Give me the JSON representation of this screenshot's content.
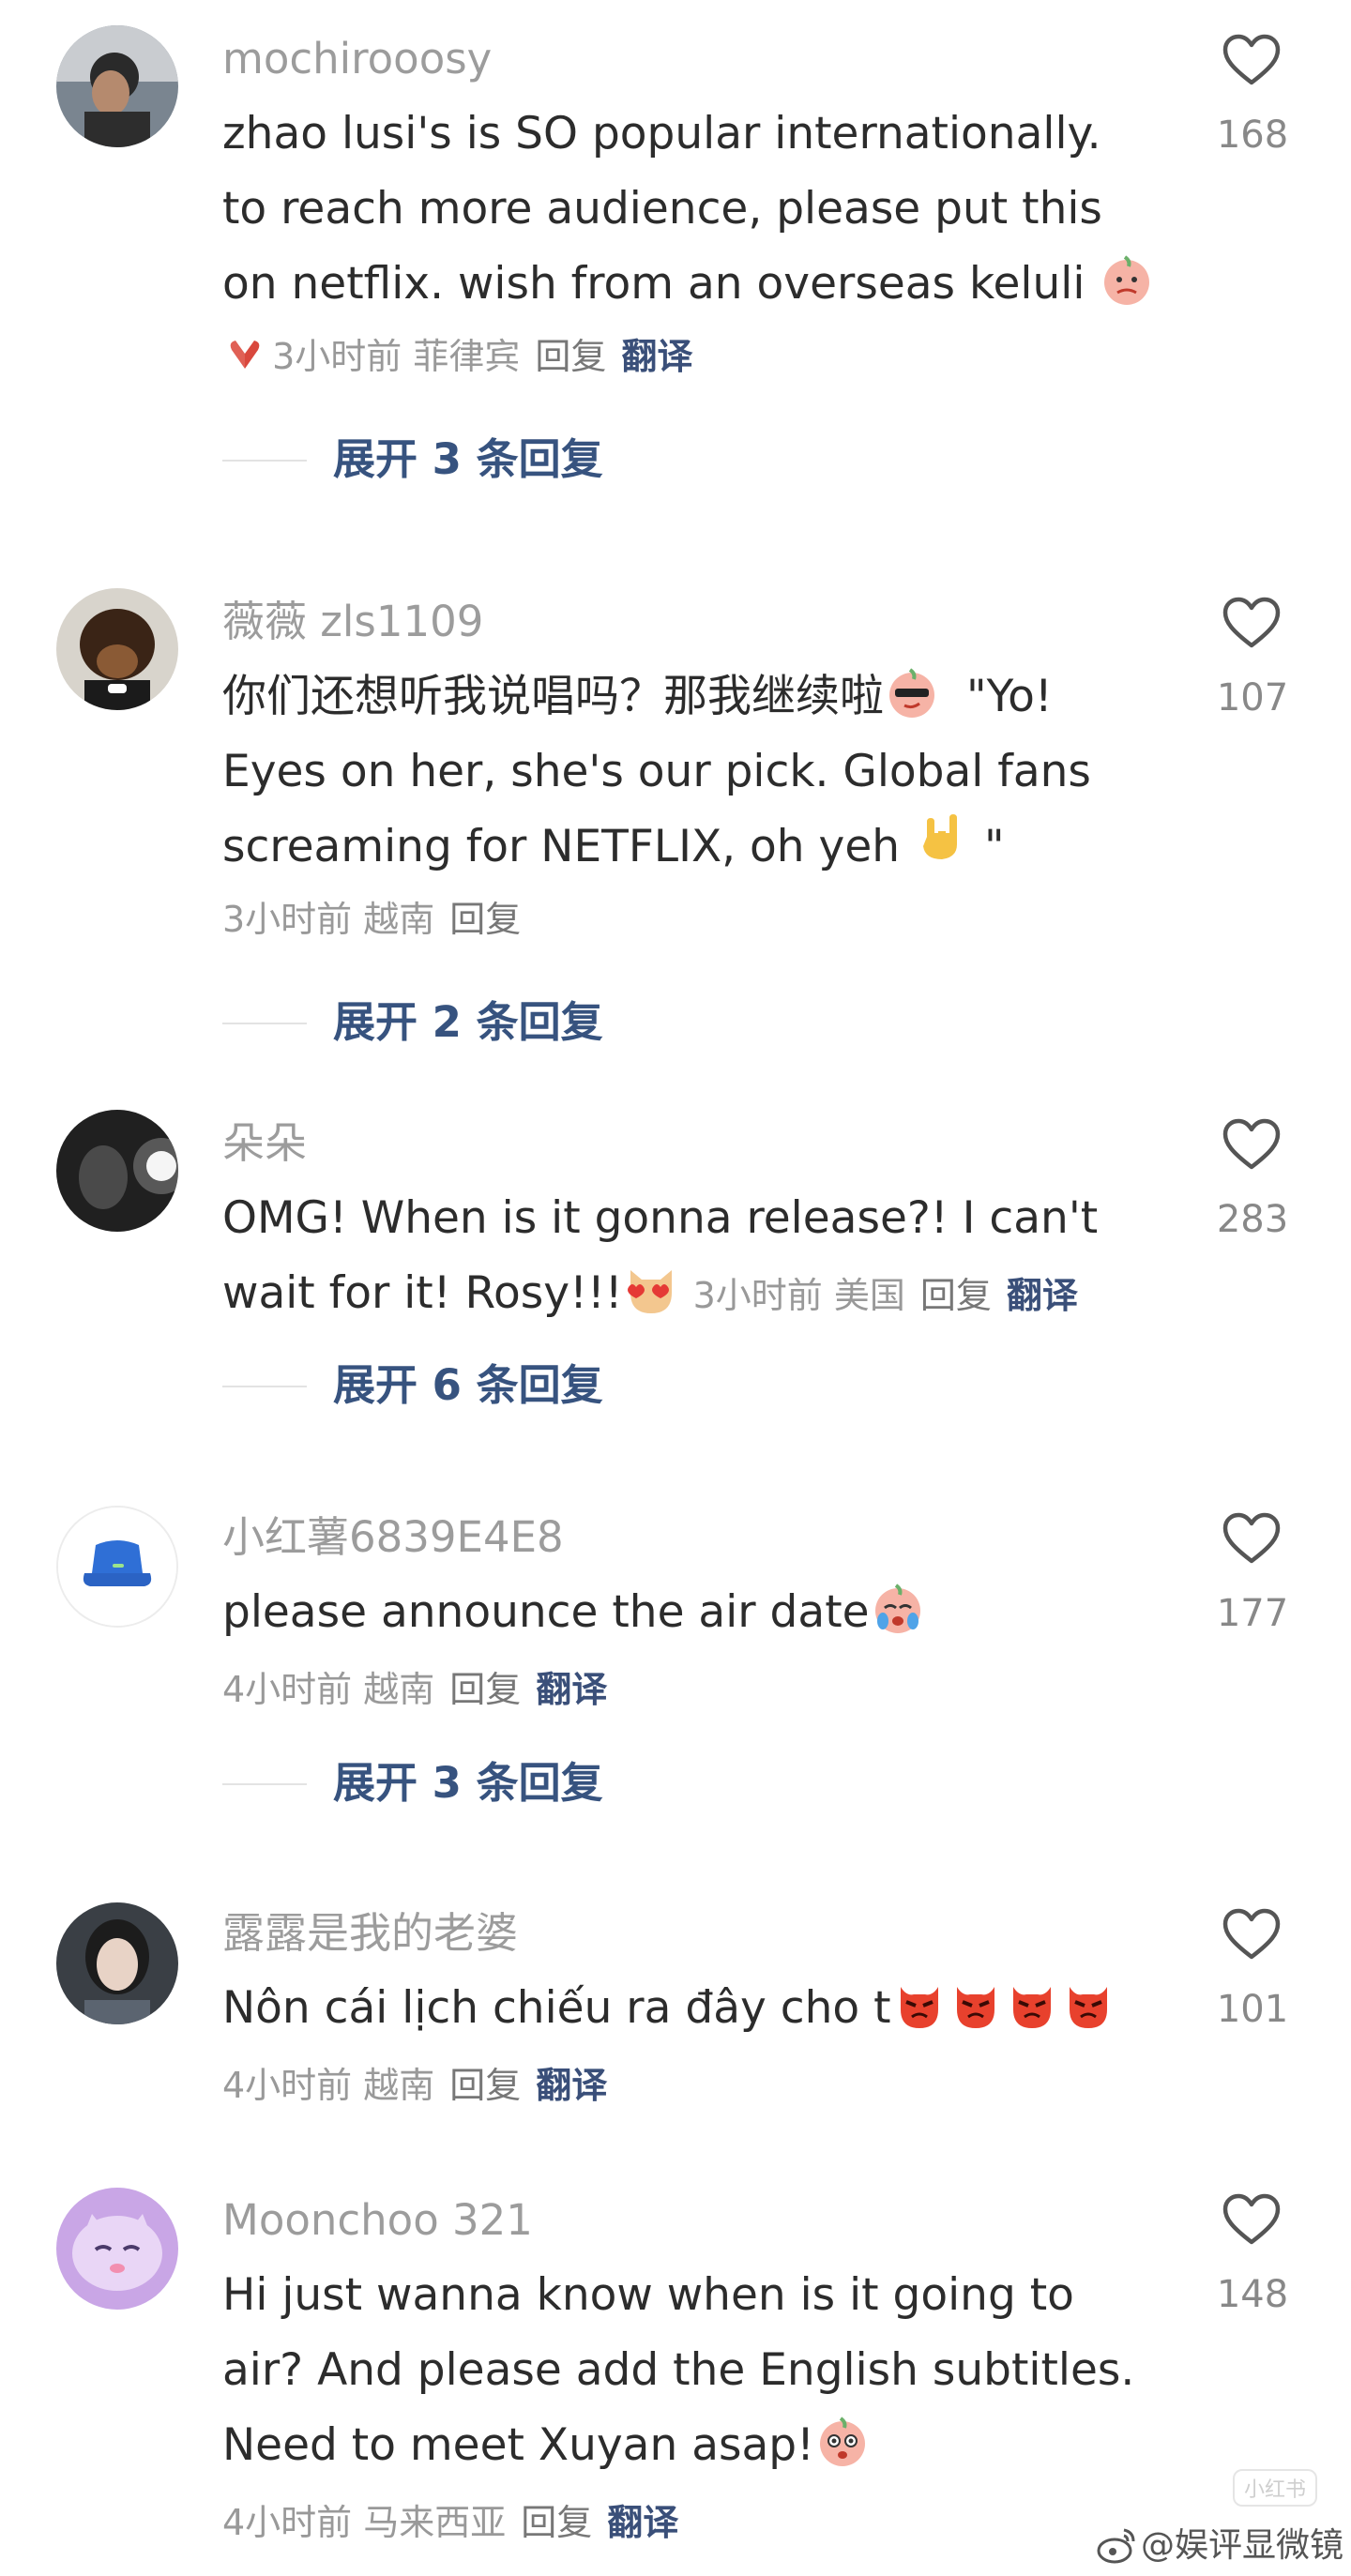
{
  "comments": [
    {
      "username": "mochirooosy",
      "lines": [
        "zhao lusi's is SO popular internationally.",
        "to reach more audience, please put this",
        "on netflix. wish from an overseas keluli"
      ],
      "meta": "3小时前 菲律宾",
      "reply": "回复",
      "translate": "翻译",
      "likes": "168",
      "expand": "展开 3 条回复"
    },
    {
      "username": "薇薇 zls1109",
      "lines": [
        "你们还想听我说唱吗？那我继续啦",
        "\"Yo!",
        "Eyes on her, she's our pick. Global fans",
        "screaming for NETFLIX, oh yeh",
        "\""
      ],
      "meta": "3小时前 越南",
      "reply": "回复",
      "likes": "107",
      "expand": "展开 2 条回复"
    },
    {
      "username": "朵朵",
      "lines": [
        "OMG! When is it gonna release?! I can't",
        "wait for it! Rosy!!!"
      ],
      "meta": "3小时前 美国",
      "reply": "回复",
      "translate": "翻译",
      "likes": "283",
      "expand": "展开 6 条回复"
    },
    {
      "username": "小红薯6839E4E8",
      "lines": [
        "please announce the air date"
      ],
      "meta": "4小时前 越南",
      "reply": "回复",
      "translate": "翻译",
      "likes": "177",
      "expand": "展开 3 条回复"
    },
    {
      "username": "露露是我的老婆",
      "lines": [
        "Nôn cái lịch chiếu ra đây cho t"
      ],
      "meta": "4小时前 越南",
      "reply": "回复",
      "translate": "翻译",
      "likes": "101"
    },
    {
      "username": "Moonchoo 321",
      "lines": [
        "Hi just wanna know when is it going to",
        "air? And please add the English subtitles.",
        "Need to meet Xuyan asap!"
      ],
      "meta": "4小时前 马来西亚",
      "reply": "回复",
      "translate": "翻译",
      "likes": "148"
    }
  ],
  "watermark": "@娱评显微镜",
  "corner_mark": "小红书",
  "icons": {
    "like": "heart-outline-icon",
    "weibo": "weibo-logo-icon"
  },
  "colors": {
    "username": "#9c9c9c",
    "text": "#2c2c2c",
    "meta": "#999999",
    "link": "#37537f",
    "heart": "#555555"
  }
}
